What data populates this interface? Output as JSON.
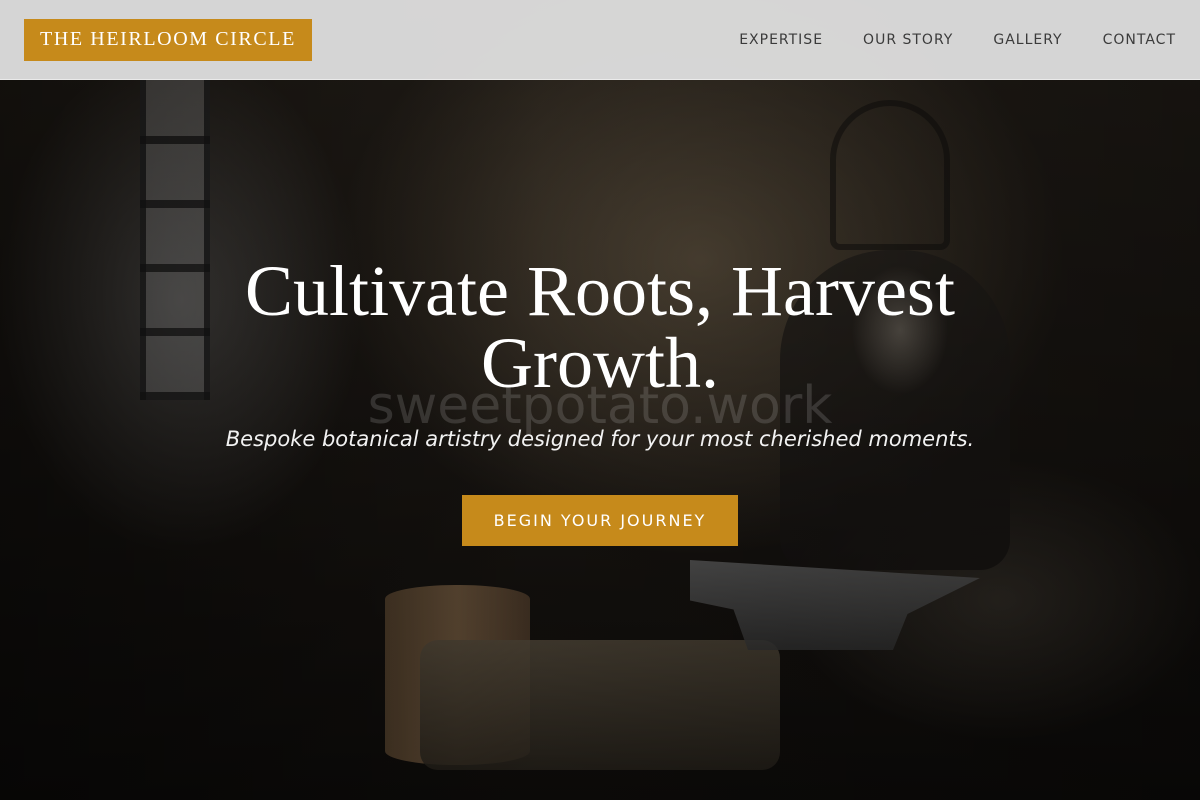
{
  "brand": {
    "logo_text": "THE HEIRLOOM CIRCLE",
    "accent_color": "#c68a1b"
  },
  "nav": {
    "items": [
      {
        "label": "EXPERTISE"
      },
      {
        "label": "OUR STORY"
      },
      {
        "label": "GALLERY"
      },
      {
        "label": "CONTACT"
      }
    ]
  },
  "hero": {
    "headline": "Cultivate Roots, Harvest Growth.",
    "subtitle": "Bespoke botanical artistry designed for your most cherished moments.",
    "cta_label": "BEGIN YOUR JOURNEY",
    "background_image": "blacksmith-workshop-photo"
  },
  "watermark": {
    "text": "sweetpotato.work"
  }
}
